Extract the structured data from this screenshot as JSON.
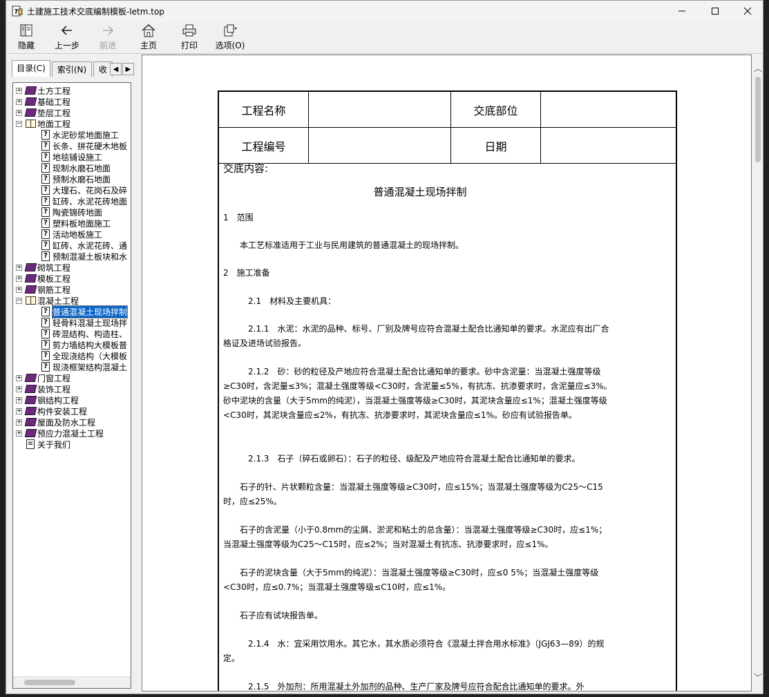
{
  "window": {
    "title": "土建施工技术交底编制模板-letm.top"
  },
  "toolbar": {
    "hide": "隐藏",
    "back": "上一步",
    "forward": "前进",
    "home": "主页",
    "print": "打印",
    "options": "选项(O)"
  },
  "tabs": {
    "contents": "目录(C)",
    "index": "索引(N)",
    "favorites": "收"
  },
  "tree": [
    {
      "label": "土方工程",
      "type": "book",
      "expander": "+"
    },
    {
      "label": "基础工程",
      "type": "book",
      "expander": "+"
    },
    {
      "label": "垫层工程",
      "type": "book",
      "expander": "+"
    },
    {
      "label": "地面工程",
      "type": "book-open",
      "expander": "−"
    },
    {
      "label": "水泥砂浆地面施工",
      "type": "page"
    },
    {
      "label": "长条、拼花硬木地板",
      "type": "page"
    },
    {
      "label": "地毯铺设施工",
      "type": "page"
    },
    {
      "label": "现制水磨石地面",
      "type": "page"
    },
    {
      "label": "预制水磨石地面",
      "type": "page"
    },
    {
      "label": "大理石、花岗石及碎",
      "type": "page"
    },
    {
      "label": "缸砖、水泥花砖地面",
      "type": "page"
    },
    {
      "label": "陶瓷锦砖地面",
      "type": "page"
    },
    {
      "label": "塑料板地面施工",
      "type": "page"
    },
    {
      "label": "活动地板施工",
      "type": "page"
    },
    {
      "label": "缸砖、水泥花砖、通",
      "type": "page"
    },
    {
      "label": "预制混凝土板块和水",
      "type": "page"
    },
    {
      "label": "砌筑工程",
      "type": "book",
      "expander": "+"
    },
    {
      "label": "模板工程",
      "type": "book",
      "expander": "+"
    },
    {
      "label": "钢筋工程",
      "type": "book",
      "expander": "+"
    },
    {
      "label": "混凝土工程",
      "type": "book-open",
      "expander": "−"
    },
    {
      "label": "普通混凝土现场拌制",
      "type": "page",
      "selected": true
    },
    {
      "label": "轻骨料混凝土现场拌",
      "type": "page"
    },
    {
      "label": "砖混结构、构造柱、",
      "type": "page"
    },
    {
      "label": "剪力墙结构大模板普",
      "type": "page"
    },
    {
      "label": "全现浇结构（大模板",
      "type": "page"
    },
    {
      "label": "现浇框架结构混凝土",
      "type": "page"
    },
    {
      "label": "门窗工程",
      "type": "book",
      "expander": "+"
    },
    {
      "label": "装饰工程",
      "type": "book",
      "expander": "+"
    },
    {
      "label": "钢结构工程",
      "type": "book",
      "expander": "+"
    },
    {
      "label": "构件安装工程",
      "type": "book",
      "expander": "+"
    },
    {
      "label": "屋面及防水工程",
      "type": "book",
      "expander": "+"
    },
    {
      "label": "预应力混凝土工程",
      "type": "book",
      "expander": "+"
    },
    {
      "label": "关于我们",
      "type": "doc"
    }
  ],
  "info_table": {
    "project_name_label": "工程名称",
    "part_label": "交底部位",
    "project_no_label": "工程编号",
    "date_label": "日期"
  },
  "document": {
    "content_label": "交底内容:",
    "title": "普通混凝土现场拌制",
    "paragraphs": [
      "1　范围",
      "　　本工艺标准适用于工业与民用建筑的普通混凝土的现场拌制。",
      "2　施工准备",
      "　　　2.1　材料及主要机具：",
      "　　　2.1.1　水泥：水泥的品种、标号、厂别及牌号应符合混凝土配合比通知单的要求。水泥应有出厂合格证及进场试验报告。",
      "　　　2.1.2　砂：砂的粒径及产地应符合混凝土配合比通知单的要求。砂中含泥量：当混凝土强度等级≥C30时，含泥量≤3%；混凝土强度等级<C30时，含泥量≤5%，有抗冻、抗渗要求时，含泥量应≤3%。砂中泥块的含量（大于5mm的纯泥），当混凝土强度等级≥C30时，其泥块含量应≤1%；混凝土强度等级<C30时，其泥块含量应≤2%，有抗冻、抗渗要求时，其泥块含量应≤1%。砂应有试验报告单。",
      "　　　2.1.3　石子（碎石或卵石）：石子的粒径、级配及产地应符合混凝土配合比通知单的要求。",
      "　　石子的针、片状颗粒含量：当混凝土强度等级≥C30时，应≤15%；当混凝土强度等级为C25～C15时，应≤25%。",
      "　　石子的含泥量（小于0.8mm的尘屑、淤泥和粘土的总含量）：当混凝土强度等级≥C30时，应≤1%；当混凝土强度等级为C25～C15时，应≤2%；当对混凝土有抗冻、抗渗要求时，应≤1%。",
      "　　石子的泥块含量（大于5mm的纯泥）：当混凝土强度等级≥C30时，应≤0 5%；当混凝土强度等级<C30时，应≤0.7%；当混凝土强度等级≤C10时，应≤1%。",
      "　　石子应有试块报告单。",
      "　　　2.1.4　水：宜采用饮用水。其它水，其水质必须符合《混凝土拌合用水标准》（JGJ63—89）的规定。",
      "　　　2.1.5　外加剂：所用混凝土外加剂的品种、生产厂家及牌号应符合配合比通知单的要求。外"
    ]
  }
}
